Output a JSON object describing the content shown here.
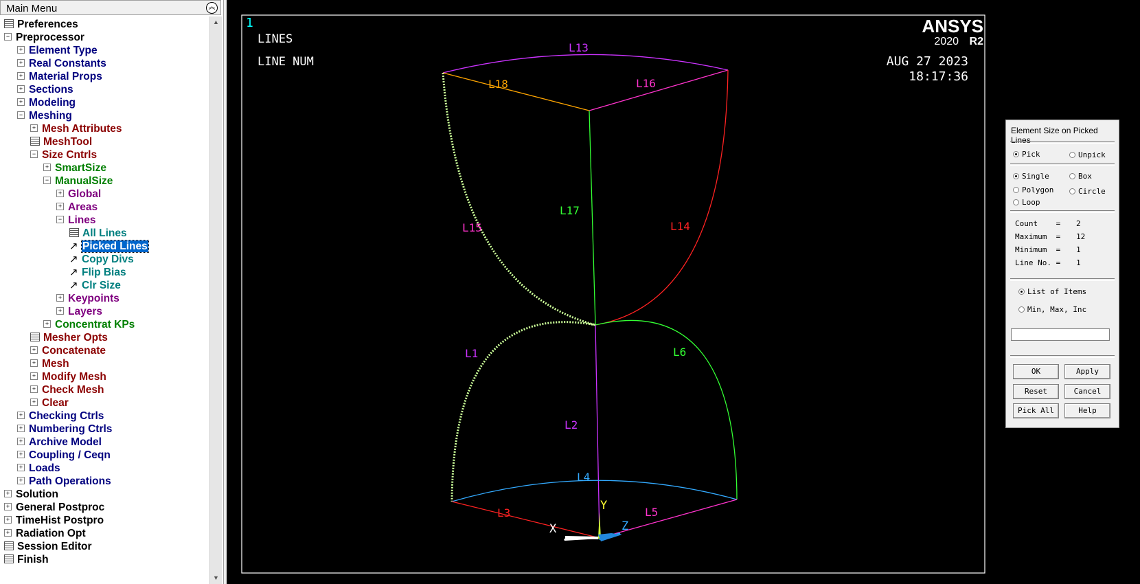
{
  "menu": {
    "title": "Main Menu",
    "collapse_icon": "double-chevron-up-icon",
    "items": [
      {
        "label": "Preferences",
        "level": 0,
        "exp": "",
        "icon": "grid",
        "color": "#000000"
      },
      {
        "label": "Preprocessor",
        "level": 0,
        "exp": "−",
        "icon": "",
        "color": "#000000"
      },
      {
        "label": "Element Type",
        "level": 1,
        "exp": "+",
        "icon": "",
        "color": "#00007f"
      },
      {
        "label": "Real Constants",
        "level": 1,
        "exp": "+",
        "icon": "",
        "color": "#00007f"
      },
      {
        "label": "Material Props",
        "level": 1,
        "exp": "+",
        "icon": "",
        "color": "#00007f"
      },
      {
        "label": "Sections",
        "level": 1,
        "exp": "+",
        "icon": "",
        "color": "#00007f"
      },
      {
        "label": "Modeling",
        "level": 1,
        "exp": "+",
        "icon": "",
        "color": "#00007f"
      },
      {
        "label": "Meshing",
        "level": 1,
        "exp": "−",
        "icon": "",
        "color": "#00007f"
      },
      {
        "label": "Mesh Attributes",
        "level": 2,
        "exp": "+",
        "icon": "",
        "color": "#8b0000"
      },
      {
        "label": "MeshTool",
        "level": 2,
        "exp": "",
        "icon": "grid",
        "color": "#8b0000"
      },
      {
        "label": "Size Cntrls",
        "level": 2,
        "exp": "−",
        "icon": "",
        "color": "#8b0000"
      },
      {
        "label": "SmartSize",
        "level": 3,
        "exp": "+",
        "icon": "",
        "color": "#007f00"
      },
      {
        "label": "ManualSize",
        "level": 3,
        "exp": "−",
        "icon": "",
        "color": "#007f00"
      },
      {
        "label": "Global",
        "level": 4,
        "exp": "+",
        "icon": "",
        "color": "#7f007f"
      },
      {
        "label": "Areas",
        "level": 4,
        "exp": "+",
        "icon": "",
        "color": "#7f007f"
      },
      {
        "label": "Lines",
        "level": 4,
        "exp": "−",
        "icon": "",
        "color": "#7f007f"
      },
      {
        "label": "All Lines",
        "level": 5,
        "exp": "",
        "icon": "grid",
        "color": "#007f7f"
      },
      {
        "label": "Picked Lines",
        "level": 5,
        "exp": "",
        "icon": "arrow",
        "color": "#007f7f",
        "selected": true
      },
      {
        "label": "Copy Divs",
        "level": 5,
        "exp": "",
        "icon": "arrow",
        "color": "#007f7f"
      },
      {
        "label": "Flip Bias",
        "level": 5,
        "exp": "",
        "icon": "arrow",
        "color": "#007f7f"
      },
      {
        "label": "Clr Size",
        "level": 5,
        "exp": "",
        "icon": "arrow",
        "color": "#007f7f"
      },
      {
        "label": "Keypoints",
        "level": 4,
        "exp": "+",
        "icon": "",
        "color": "#7f007f"
      },
      {
        "label": "Layers",
        "level": 4,
        "exp": "+",
        "icon": "",
        "color": "#7f007f"
      },
      {
        "label": "Concentrat KPs",
        "level": 3,
        "exp": "+",
        "icon": "",
        "color": "#007f00"
      },
      {
        "label": "Mesher Opts",
        "level": 2,
        "exp": "",
        "icon": "grid",
        "color": "#8b0000"
      },
      {
        "label": "Concatenate",
        "level": 2,
        "exp": "+",
        "icon": "",
        "color": "#8b0000"
      },
      {
        "label": "Mesh",
        "level": 2,
        "exp": "+",
        "icon": "",
        "color": "#8b0000"
      },
      {
        "label": "Modify Mesh",
        "level": 2,
        "exp": "+",
        "icon": "",
        "color": "#8b0000"
      },
      {
        "label": "Check Mesh",
        "level": 2,
        "exp": "+",
        "icon": "",
        "color": "#8b0000"
      },
      {
        "label": "Clear",
        "level": 2,
        "exp": "+",
        "icon": "",
        "color": "#8b0000"
      },
      {
        "label": "Checking Ctrls",
        "level": 1,
        "exp": "+",
        "icon": "",
        "color": "#00007f"
      },
      {
        "label": "Numbering Ctrls",
        "level": 1,
        "exp": "+",
        "icon": "",
        "color": "#00007f"
      },
      {
        "label": "Archive Model",
        "level": 1,
        "exp": "+",
        "icon": "",
        "color": "#00007f"
      },
      {
        "label": "Coupling / Ceqn",
        "level": 1,
        "exp": "+",
        "icon": "",
        "color": "#00007f"
      },
      {
        "label": "Loads",
        "level": 1,
        "exp": "+",
        "icon": "",
        "color": "#00007f"
      },
      {
        "label": "Path Operations",
        "level": 1,
        "exp": "+",
        "icon": "",
        "color": "#00007f"
      },
      {
        "label": "Solution",
        "level": 0,
        "exp": "+",
        "icon": "",
        "color": "#000000"
      },
      {
        "label": "General Postproc",
        "level": 0,
        "exp": "+",
        "icon": "",
        "color": "#000000"
      },
      {
        "label": "TimeHist Postpro",
        "level": 0,
        "exp": "+",
        "icon": "",
        "color": "#000000"
      },
      {
        "label": "Radiation Opt",
        "level": 0,
        "exp": "+",
        "icon": "",
        "color": "#000000"
      },
      {
        "label": "Session Editor",
        "level": 0,
        "exp": "",
        "icon": "grid",
        "color": "#000000"
      },
      {
        "label": "Finish",
        "level": 0,
        "exp": "",
        "icon": "grid",
        "color": "#000000"
      }
    ]
  },
  "graphics": {
    "window_number": "1",
    "line1": "LINES",
    "line2": "LINE NUM",
    "brand": "ANSYS",
    "version": "2020",
    "release": "R2",
    "date": "AUG 27 2023",
    "time": "18:17:36",
    "line_labels": [
      "L13",
      "L18",
      "L16",
      "L17",
      "L15",
      "L14",
      "L1",
      "L6",
      "L2",
      "L4",
      "L3",
      "L5"
    ],
    "axis_labels": {
      "x": "X",
      "y": "Y",
      "z": "Z"
    }
  },
  "picker": {
    "title": "Element Size on Picked Lines",
    "pick": "Pick",
    "unpick": "Unpick",
    "single": "Single",
    "box": "Box",
    "polygon": "Polygon",
    "circle": "Circle",
    "loop": "Loop",
    "count_label": "Count    =",
    "count": "2",
    "max_label": "Maximum  =",
    "max": "12",
    "min_label": "Minimum  =",
    "min": "1",
    "lineno_label": "Line No. =",
    "lineno": "1",
    "list_items": "List of Items",
    "min_max_inc": "Min, Max, Inc",
    "input_value": "",
    "ok": "OK",
    "apply": "Apply",
    "reset": "Reset",
    "cancel": "Cancel",
    "pick_all": "Pick All",
    "help": "Help"
  }
}
